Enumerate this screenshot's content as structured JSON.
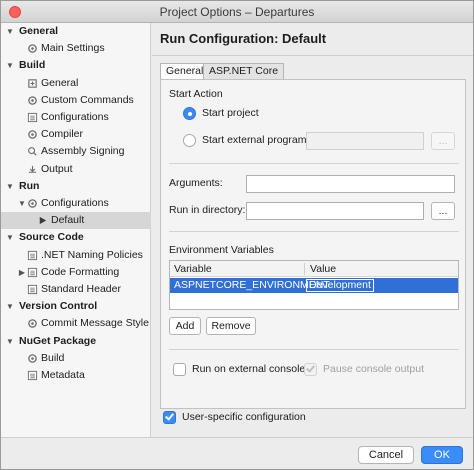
{
  "window": {
    "title": "Project Options – Departures"
  },
  "sidebar": {
    "items": [
      {
        "label": "General",
        "level": 0,
        "expanded": true,
        "icon": "none"
      },
      {
        "label": "Main Settings",
        "level": 1,
        "icon": "gear-icon"
      },
      {
        "label": "Build",
        "level": 0,
        "expanded": true,
        "icon": "none"
      },
      {
        "label": "General",
        "level": 1,
        "icon": "build-icon"
      },
      {
        "label": "Custom Commands",
        "level": 1,
        "icon": "gear-icon"
      },
      {
        "label": "Configurations",
        "level": 1,
        "icon": "list-icon"
      },
      {
        "label": "Compiler",
        "level": 1,
        "icon": "gear-icon"
      },
      {
        "label": "Assembly Signing",
        "level": 1,
        "icon": "signing-icon"
      },
      {
        "label": "Output",
        "level": 1,
        "icon": "output-icon"
      },
      {
        "label": "Run",
        "level": 0,
        "expanded": true,
        "icon": "none"
      },
      {
        "label": "Configurations",
        "level": 1,
        "expanded": true,
        "icon": "gear-icon"
      },
      {
        "label": "Default",
        "level": 2,
        "icon": "play-icon",
        "selected": true
      },
      {
        "label": "Source Code",
        "level": 0,
        "expanded": true,
        "icon": "none"
      },
      {
        "label": ".NET Naming Policies",
        "level": 1,
        "icon": "list-icon"
      },
      {
        "label": "Code Formatting",
        "level": 1,
        "expanded": false,
        "icon": "list-icon"
      },
      {
        "label": "Standard Header",
        "level": 1,
        "icon": "list-icon"
      },
      {
        "label": "Version Control",
        "level": 0,
        "expanded": true,
        "icon": "none"
      },
      {
        "label": "Commit Message Style",
        "level": 1,
        "icon": "gear-icon"
      },
      {
        "label": "NuGet Package",
        "level": 0,
        "expanded": true,
        "icon": "none"
      },
      {
        "label": "Build",
        "level": 1,
        "icon": "gear-icon"
      },
      {
        "label": "Metadata",
        "level": 1,
        "icon": "list-icon"
      }
    ]
  },
  "main": {
    "title": "Run Configuration: Default",
    "tabs": [
      {
        "label": "General",
        "active": true
      },
      {
        "label": "ASP.NET Core",
        "active": false
      }
    ],
    "start_action": {
      "heading": "Start Action",
      "start_project": "Start project",
      "start_external": "Start external program:",
      "external_program_value": "",
      "browse": "..."
    },
    "arguments": {
      "label": "Arguments:",
      "value": ""
    },
    "run_in_directory": {
      "label": "Run in directory:",
      "value": "",
      "browse": "..."
    },
    "env": {
      "heading": "Environment Variables",
      "col_variable": "Variable",
      "col_value": "Value",
      "rows": [
        {
          "variable": "ASPNETCORE_ENVIRONMENT",
          "value": "Development"
        }
      ],
      "add": "Add",
      "remove": "Remove"
    },
    "run_external_console": "Run on external console",
    "pause_console_output": "Pause console output",
    "user_specific": "User-specific configuration"
  },
  "footer": {
    "cancel": "Cancel",
    "ok": "OK"
  },
  "colors": {
    "accent": "#3b8bf5",
    "selection": "#2f6fd6",
    "close_button": "#fc605c"
  }
}
